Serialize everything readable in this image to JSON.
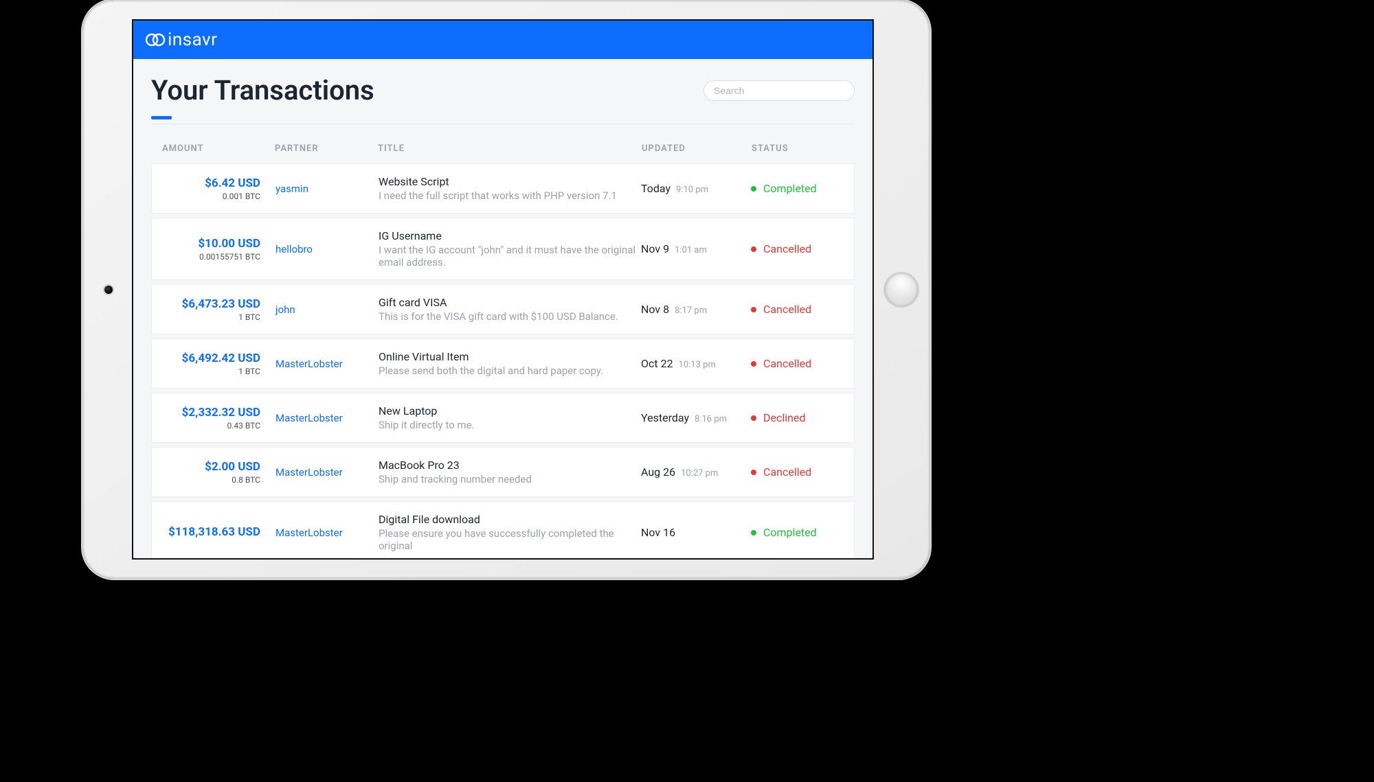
{
  "brand": "insavr",
  "page_title": "Your Transactions",
  "search_placeholder": "Search",
  "columns": {
    "amount": "AMOUNT",
    "partner": "PARTNER",
    "title": "TITLE",
    "updated": "UPDATED",
    "status": "STATUS"
  },
  "status_colors": {
    "Completed": "green",
    "Cancelled": "red",
    "Declined": "red"
  },
  "transactions": [
    {
      "usd": "$6.42 USD",
      "btc": "0.001 BTC",
      "partner": "yasmin",
      "title": "Website Script",
      "desc": "I need the full script that works with PHP version 7.1",
      "updated_date": "Today",
      "updated_time": "9:10 pm",
      "status": "Completed"
    },
    {
      "usd": "$10.00 USD",
      "btc": "0.00155751 BTC",
      "partner": "hellobro",
      "title": "IG Username",
      "desc": "I want the IG account \"john\" and it must have the original email address.",
      "updated_date": "Nov 9",
      "updated_time": "1:01 am",
      "status": "Cancelled"
    },
    {
      "usd": "$6,473.23 USD",
      "btc": "1 BTC",
      "partner": "john",
      "title": "Gift card VISA",
      "desc": "This is for the VISA gift card with $100 USD Balance.",
      "updated_date": "Nov 8",
      "updated_time": "8:17 pm",
      "status": "Cancelled"
    },
    {
      "usd": "$6,492.42 USD",
      "btc": "1 BTC",
      "partner": "MasterLobster",
      "title": "Online Virtual Item",
      "desc": "Please send both the digital and hard paper copy.",
      "updated_date": "Oct 22",
      "updated_time": "10:13 pm",
      "status": "Cancelled"
    },
    {
      "usd": "$2,332.32 USD",
      "btc": "0.43 BTC",
      "partner": "MasterLobster",
      "title": "New Laptop",
      "desc": "Ship it directly to me.",
      "updated_date": "Yesterday",
      "updated_time": "8:16 pm",
      "status": "Declined"
    },
    {
      "usd": "$2.00 USD",
      "btc": "0.8 BTC",
      "partner": "MasterLobster",
      "title": "MacBook Pro 23",
      "desc": "Ship and tracking number needed",
      "updated_date": "Aug 26",
      "updated_time": "10:27 pm",
      "status": "Cancelled"
    },
    {
      "usd": "$118,318.63 USD",
      "btc": "",
      "partner": "MasterLobster",
      "title": "Digital File download",
      "desc": "Please ensure you have successfully completed the original",
      "updated_date": "Nov 16",
      "updated_time": "",
      "status": "Completed"
    }
  ]
}
